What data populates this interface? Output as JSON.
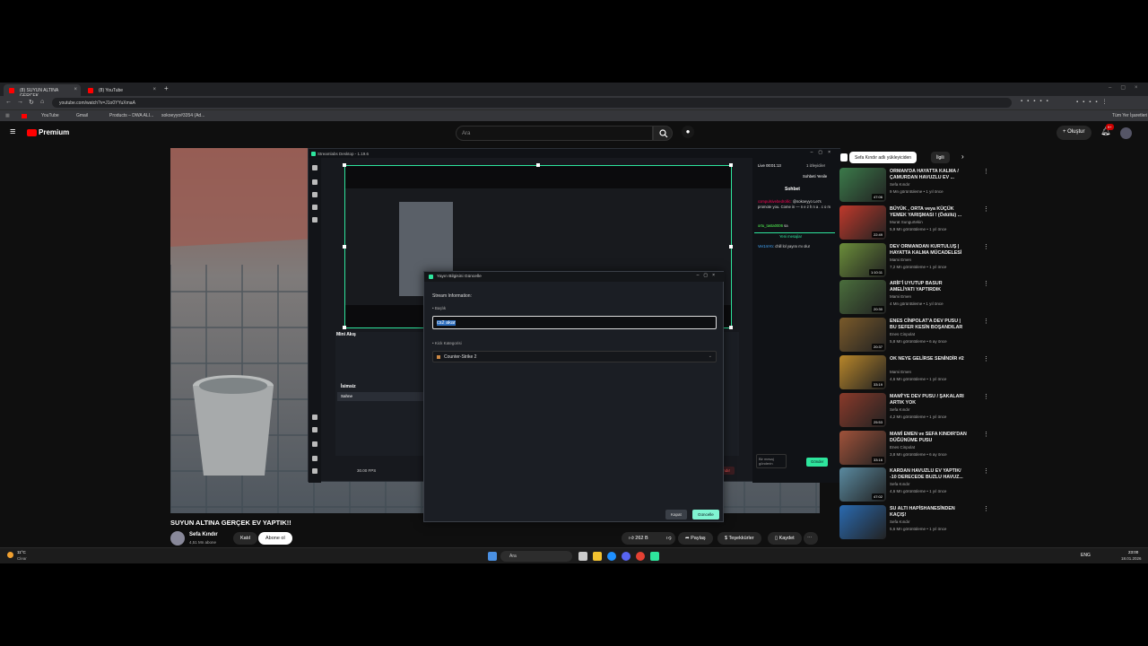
{
  "browser": {
    "tabs": [
      {
        "label": "(8) SUYUN ALTINA GERÇEK"
      },
      {
        "label": "(8) YouTube"
      }
    ],
    "url": "youtube.com/watch?v=J1o0YYuXmaA",
    "bookmarks": [
      "YouTube",
      "Gmail",
      "Products – DWA ALI...",
      "sokoeyyo#3354 (Ad..."
    ],
    "all_bookmarks": "Tüm Yer İşaretleri"
  },
  "youtube": {
    "logo_label": "Premium",
    "search_placeholder": "Ara",
    "create_label": "Oluştur",
    "notif_count": "9+",
    "video_title": "SUYUN ALTINA GERÇEK EV YAPTIK!!",
    "channel_name": "Sefa Kındır",
    "subscribers": "4,51 Mn abone",
    "join_label": "Katıl",
    "subscribe_label": "Abone ol",
    "likes": "262 B",
    "share_label": "Paylaş",
    "thanks_label": "Teşekkürler",
    "save_label": "Kaydet",
    "chips": [
      "Sefa Kındır adlı yükleyiciden",
      "İlgili"
    ]
  },
  "obs": {
    "title": "Streamlabs Desktop - 1.19.6",
    "mini_title": "Mini Akış",
    "scene_collection": "İsimsiz",
    "scene_label": "Sahne",
    "fps": "30.00 FPS",
    "test_label": "Test Pencere Öğeleri",
    "stop_label": "Yayını Sonlandır",
    "live_time": "Live 00:01:13",
    "viewers": "1 izleyiciler",
    "refresh_chat": "Sohbeti Yenile",
    "chat_title": "Sohbet",
    "chat_1_user": "compulsivebedrollic:",
    "chat_1_text": "@sokoeyyo Let's promote you. Come in — n e z h n a . c o m",
    "chat_2_user": "ortu_tasta0006",
    "chat_2_text": "sa",
    "new_messages": "Yeni mesajlar",
    "chat_3_user": "Ver1mYo:",
    "chat_3_text": "chill lol yayını mı olur",
    "send_placeholder": "Bir mesaj gönderin",
    "send_label": "Gönder"
  },
  "dialog": {
    "title": "Yayın Bilgisini Güncelle",
    "section": "Stream Information:",
    "title_field_label": "• Başlık",
    "title_value": "cs2 akar",
    "category_label": "• Kick Kategorisi",
    "category_value": "Counter-Strike 2",
    "cancel_label": "Kapat",
    "update_label": "Güncelle"
  },
  "recommendations": [
    {
      "title": "ORMAN'DA HAYATTA KALMA / ÇAMURDAN HAVUZLU EV ...",
      "channel": "Sefa Kındır",
      "meta": "9 Mn görüntüleme • 1 yıl önce",
      "duration": "47:06",
      "color": "#3b7a4a"
    },
    {
      "title": "BÜYÜK , ORTA veya KÜÇÜK YEMEK YARIŞMASI ! (Ödüllü) ...",
      "channel": "Murat Sungurtekin",
      "meta": "5,9 Mn görüntüleme • 1 yıl önce",
      "duration": "22:49",
      "color": "#c0392b"
    },
    {
      "title": "DEV ORMANDAN KURTULUŞ | HAYATTA KALMA MÜCADELESİ",
      "channel": "Mami Emen",
      "meta": "7,2 Mn görüntüleme • 1 yıl önce",
      "duration": "1:10:11",
      "color": "#6b8e3a"
    },
    {
      "title": "ARİF'İ UYUTUP BASUR AMELİYATI YAPTIRDIK",
      "channel": "Mami Emen",
      "meta": "4 Mn görüntüleme • 1 yıl önce",
      "duration": "20:30",
      "color": "#4a6e3c"
    },
    {
      "title": "ENES CİNPOLAT'A DEV PUSU | BU SEFER KESİN BOŞANDILAR",
      "channel": "Enes Cinpolat",
      "meta": "5,8 Mn görüntüleme • 6 ay önce",
      "duration": "20:37",
      "color": "#7a5a2a"
    },
    {
      "title": "OK NEYE GELİRSE SENİNDİR #2",
      "channel": "Mami Emen",
      "meta": "4,6 Mn görüntüleme • 1 yıl önce",
      "duration": "33:19",
      "color": "#b8862a"
    },
    {
      "title": "MAMİ'YE DEV PUSU / ŞAKALARI ARTIK YOK",
      "channel": "Sefa Kındır",
      "meta": "4,2 Mn görüntüleme • 1 yıl önce",
      "duration": "25:53",
      "color": "#8a3a2a"
    },
    {
      "title": "MAMİ EMEN ve SEFA KINDIR'DAN DÜĞÜNÜME PUSU",
      "channel": "Enes Cinpolat",
      "meta": "3,8 Mn görüntüleme • 6 ay önce",
      "duration": "33:16",
      "color": "#a0523a"
    },
    {
      "title": "KARDAN HAVUZLU EV YAPTIK/ -10 DERECEDE BUZLU HAVUZ...",
      "channel": "Sefa Kındır",
      "meta": "4,6 Mn görüntüleme • 1 yıl önce",
      "duration": "47:02",
      "color": "#5a8aa0"
    },
    {
      "title": "SU ALTI HAPİSHANESİNDEN KAÇIŞ!",
      "channel": "Sefa Kındır",
      "meta": "5,6 Mn görüntüleme • 1 yıl önce",
      "duration": "",
      "color": "#2a6ab0"
    }
  ],
  "taskbar": {
    "weather_temp": "11°C",
    "weather_desc": "Clear",
    "search_label": "Ara",
    "lang": "ENG",
    "time": "23:00",
    "date": "18.01.2026"
  }
}
